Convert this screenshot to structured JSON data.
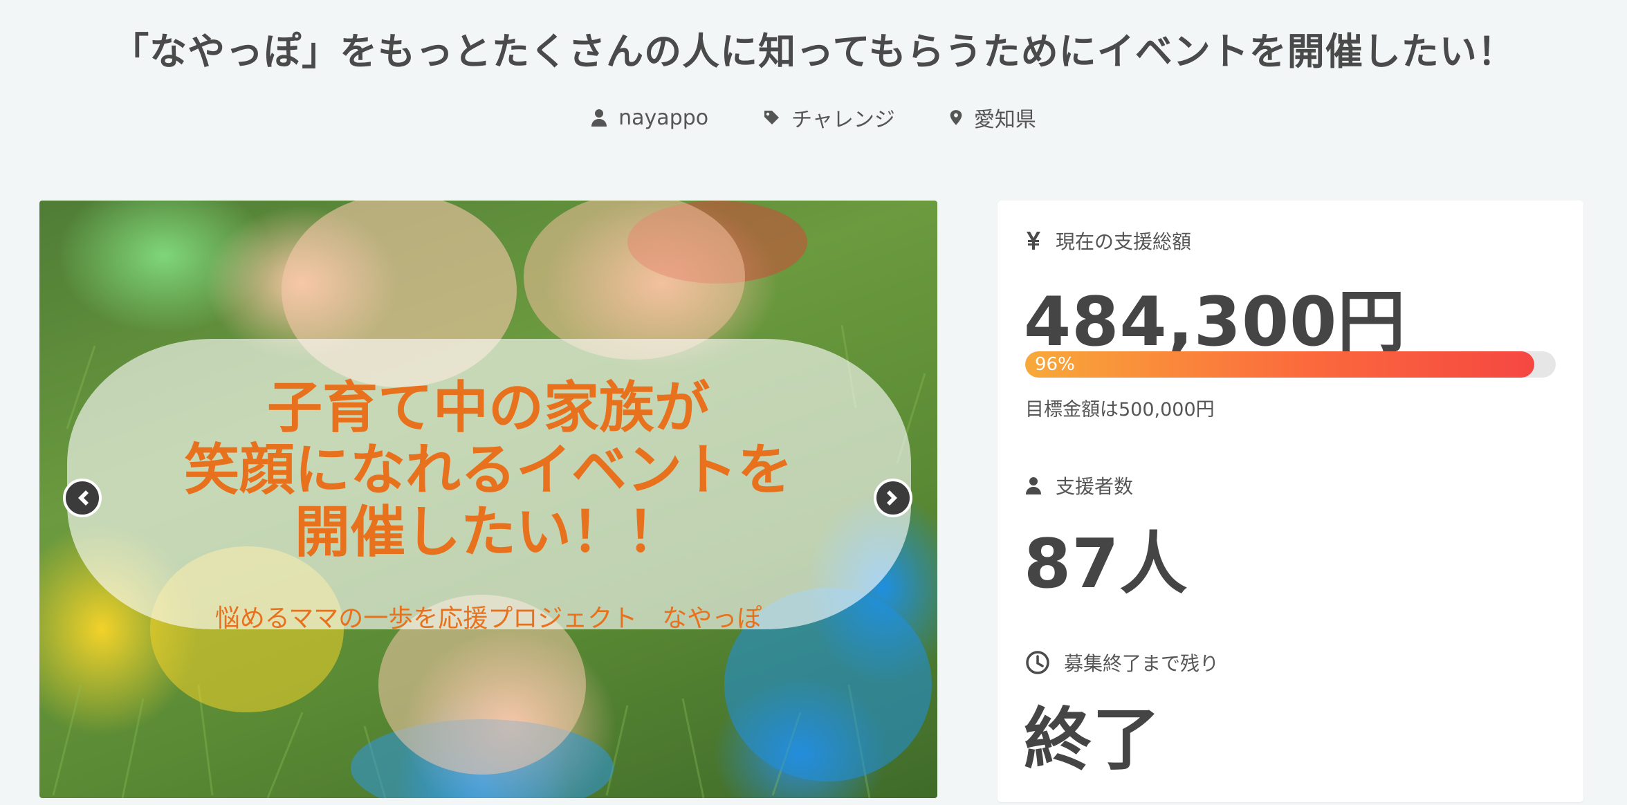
{
  "project": {
    "title": "「なやっぽ」をもっとたくさんの人に知ってもらうためにイベントを開催したい！",
    "owner": "nayappo",
    "category": "チャレンジ",
    "location": "愛知県"
  },
  "hero": {
    "headline_lines": [
      "子育て中の家族が",
      "笑顔になれるイベントを",
      "開催したい！！"
    ],
    "subline": "悩めるママの一歩を応援プロジェクト　なやっぽ"
  },
  "stats": {
    "funding_label": "現在の支援総額",
    "funding_amount": "484,300円",
    "progress_text": "96%",
    "progress_fraction": 0.96,
    "goal_text": "目標金額は500,000円",
    "supporters_label": "支援者数",
    "supporters_count": "87人",
    "time_label": "募集終了まで残り",
    "time_value": "終了"
  },
  "colors": {
    "accent_orange": "#e8711d",
    "progress_start": "#f8a93a",
    "progress_end": "#f54742",
    "text_dark": "#454545",
    "background": "#f3f6f7"
  },
  "icons": {
    "owner": "user-icon",
    "category": "tag-icon",
    "location": "map-pin-icon",
    "funding": "yen-icon",
    "supporters": "user-icon",
    "time": "clock-icon",
    "prev": "chevron-left-icon",
    "next": "chevron-right-icon"
  }
}
